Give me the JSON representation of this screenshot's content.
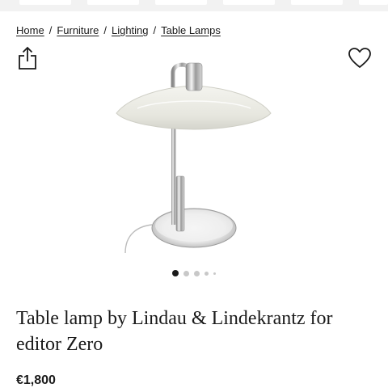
{
  "breadcrumb": {
    "items": [
      {
        "label": "Home"
      },
      {
        "label": "Furniture"
      },
      {
        "label": "Lighting"
      },
      {
        "label": "Table Lamps"
      }
    ],
    "separator": "/"
  },
  "toolbar": {
    "share_icon": "share-icon",
    "favorite_icon": "heart-icon"
  },
  "gallery": {
    "image_subject": "chrome table lamp with white shade",
    "image_count": 5,
    "active_index": 0
  },
  "product": {
    "title": "Table lamp by Lindau & Lindekrantz for editor Zero",
    "price": "€1,800"
  },
  "colors": {
    "text": "#1a1a1a",
    "dot_active": "#1a1a1a",
    "dot_inactive": "#c8c8c8",
    "background": "#ffffff"
  }
}
